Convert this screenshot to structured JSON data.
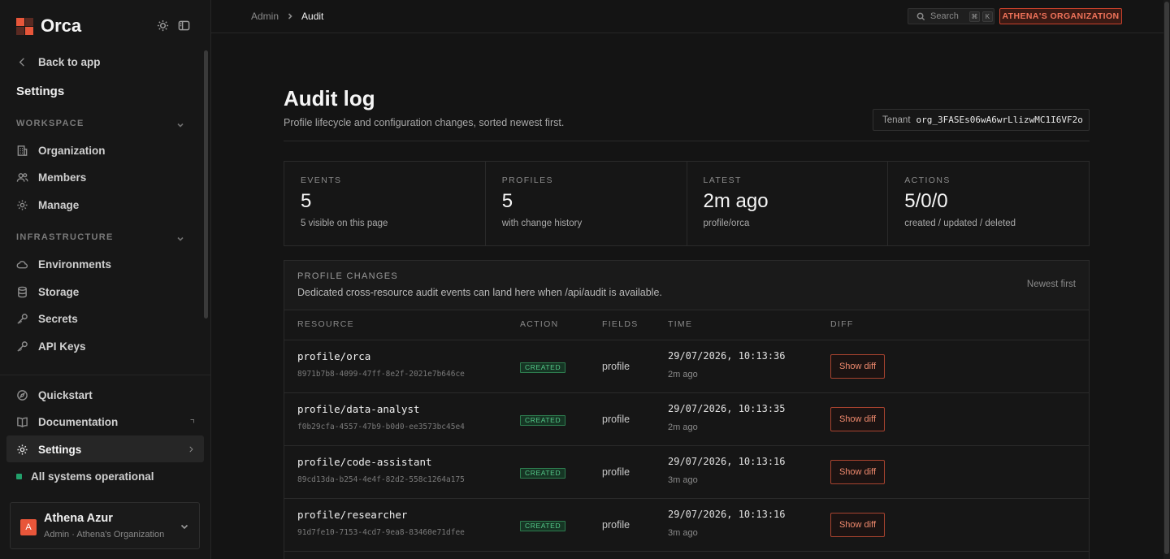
{
  "brand": {
    "name": "Orca"
  },
  "sidebar": {
    "back_label": "Back to app",
    "settings_heading": "Settings",
    "workspace_title": "WORKSPACE",
    "workspace_items": [
      {
        "label": "Organization",
        "icon": "building-icon"
      },
      {
        "label": "Members",
        "icon": "users-icon"
      },
      {
        "label": "Manage",
        "icon": "gear-icon"
      }
    ],
    "infra_title": "INFRASTRUCTURE",
    "infra_items": [
      {
        "label": "Environments",
        "icon": "cloud-icon"
      },
      {
        "label": "Storage",
        "icon": "database-icon"
      },
      {
        "label": "Secrets",
        "icon": "key-icon"
      },
      {
        "label": "API Keys",
        "icon": "key-icon"
      }
    ],
    "bottom_items": [
      {
        "label": "Quickstart",
        "icon": "compass-icon"
      },
      {
        "label": "Documentation",
        "icon": "book-icon"
      },
      {
        "label": "Settings",
        "icon": "gear-icon"
      }
    ],
    "status_label": "All systems operational",
    "user": {
      "initial": "A",
      "name": "Athena Azur",
      "subtitle": "Admin · Athena's Organization"
    }
  },
  "topbar": {
    "breadcrumb": [
      "Admin",
      "Audit"
    ],
    "search_placeholder": "Search",
    "search_keys": [
      "⌘",
      "K"
    ],
    "org_badge": "ATHENA'S ORGANIZATION"
  },
  "main": {
    "title": "Audit log",
    "subtitle": "Profile lifecycle and configuration changes, sorted newest first.",
    "tenant_label": "Tenant",
    "tenant_id": "org_3FASEs06wA6wrLlizwMC1I6VF2o",
    "stats": [
      {
        "label": "EVENTS",
        "value": "5",
        "sub": "5 visible on this page"
      },
      {
        "label": "PROFILES",
        "value": "5",
        "sub": "with change history"
      },
      {
        "label": "LATEST",
        "value": "2m ago",
        "sub": "profile/orca"
      },
      {
        "label": "ACTIONS",
        "value": "5/0/0",
        "sub": "created / updated / deleted"
      }
    ],
    "panel": {
      "title": "PROFILE CHANGES",
      "description": "Dedicated cross-resource audit events can land here when /api/audit is available.",
      "sort_label": "Newest first",
      "columns": [
        "RESOURCE",
        "ACTION",
        "FIELDS",
        "TIME",
        "DIFF"
      ],
      "rows": [
        {
          "resource": "profile/orca",
          "id": "8971b7b8-4099-47ff-8e2f-2021e7b646ce",
          "action": "CREATED",
          "fields": "profile",
          "time": "29/07/2026, 10:13:36",
          "ago": "2m ago",
          "diff_label": "Show diff"
        },
        {
          "resource": "profile/data-analyst",
          "id": "f0b29cfa-4557-47b9-b0d0-ee3573bc45e4",
          "action": "CREATED",
          "fields": "profile",
          "time": "29/07/2026, 10:13:35",
          "ago": "2m ago",
          "diff_label": "Show diff"
        },
        {
          "resource": "profile/code-assistant",
          "id": "89cd13da-b254-4e4f-82d2-558c1264a175",
          "action": "CREATED",
          "fields": "profile",
          "time": "29/07/2026, 10:13:16",
          "ago": "3m ago",
          "diff_label": "Show diff"
        },
        {
          "resource": "profile/researcher",
          "id": "91d7fe10-7153-4cd7-9ea8-83460e71dfee",
          "action": "CREATED",
          "fields": "profile",
          "time": "29/07/2026, 10:13:16",
          "ago": "3m ago",
          "diff_label": "Show diff"
        }
      ]
    }
  },
  "colors": {
    "accent": "#e8563a",
    "success": "#56c98a",
    "status": "#22a06b"
  }
}
